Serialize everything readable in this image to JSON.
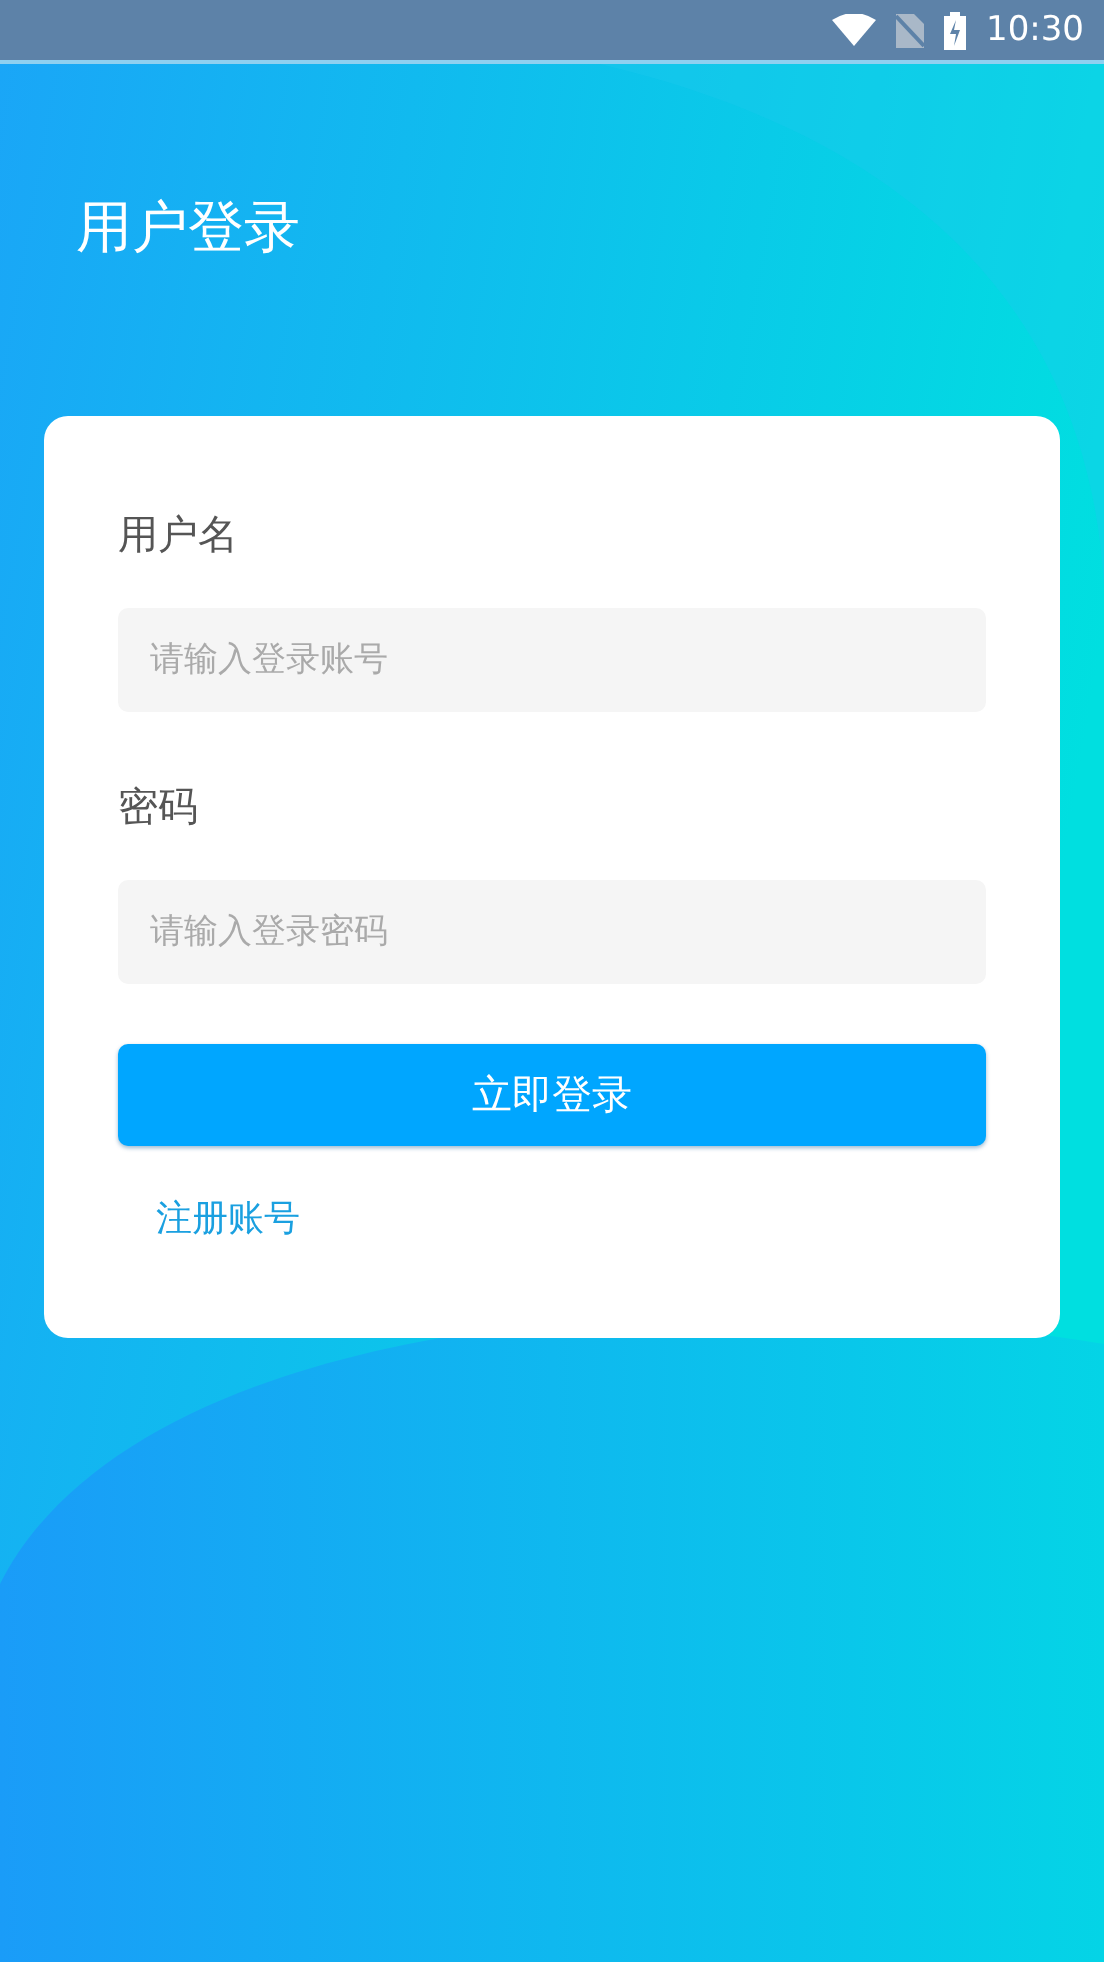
{
  "status_bar": {
    "time": "10:30"
  },
  "title": "用户登录",
  "form": {
    "fields": [
      {
        "label": "用户名",
        "placeholder": "请输入登录账号"
      },
      {
        "label": "密码",
        "placeholder": "请输入登录密码"
      }
    ],
    "submit": "立即登录",
    "register_link": "注册账号"
  }
}
